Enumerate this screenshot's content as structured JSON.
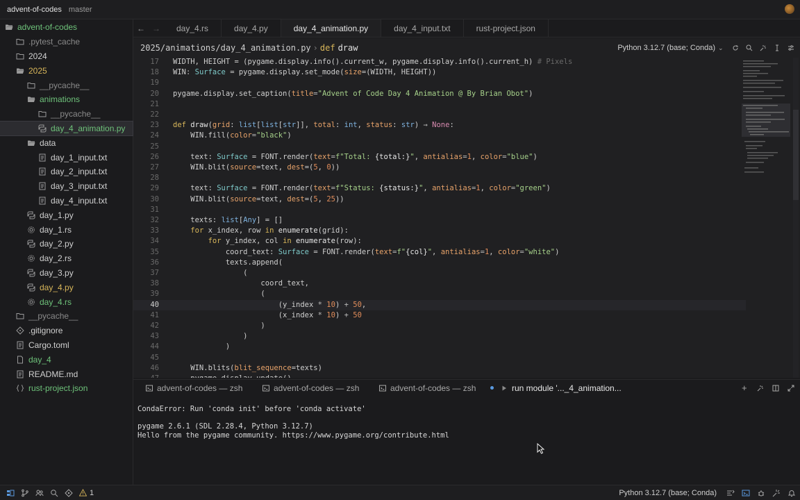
{
  "titlebar": {
    "project": "advent-of-codes",
    "branch": "master"
  },
  "sidebar": {
    "items": [
      {
        "label": "advent-of-codes",
        "icon": "folder-open-icon",
        "depth": 0,
        "color": "green"
      },
      {
        "label": ".pytest_cache",
        "icon": "folder-icon",
        "depth": 1,
        "color": "dim"
      },
      {
        "label": "2024",
        "icon": "folder-icon",
        "depth": 1,
        "color": "white"
      },
      {
        "label": "2025",
        "icon": "folder-open-icon",
        "depth": 1,
        "color": "yellow"
      },
      {
        "label": "__pycache__",
        "icon": "folder-icon",
        "depth": 2,
        "color": "dim"
      },
      {
        "label": "animations",
        "icon": "folder-open-icon",
        "depth": 2,
        "color": "green"
      },
      {
        "label": "__pycache__",
        "icon": "folder-icon",
        "depth": 3,
        "color": "dim"
      },
      {
        "label": "day_4_animation.py",
        "icon": "python-file-icon",
        "depth": 3,
        "color": "green",
        "selected": true
      },
      {
        "label": "data",
        "icon": "folder-open-icon",
        "depth": 2,
        "color": "white"
      },
      {
        "label": "day_1_input.txt",
        "icon": "text-file-icon",
        "depth": 3,
        "color": "white"
      },
      {
        "label": "day_2_input.txt",
        "icon": "text-file-icon",
        "depth": 3,
        "color": "white"
      },
      {
        "label": "day_3_input.txt",
        "icon": "text-file-icon",
        "depth": 3,
        "color": "white"
      },
      {
        "label": "day_4_input.txt",
        "icon": "text-file-icon",
        "depth": 3,
        "color": "white"
      },
      {
        "label": "day_1.py",
        "icon": "python-file-icon",
        "depth": 2,
        "color": "white"
      },
      {
        "label": "day_1.rs",
        "icon": "rust-file-icon",
        "depth": 2,
        "color": "white"
      },
      {
        "label": "day_2.py",
        "icon": "python-file-icon",
        "depth": 2,
        "color": "white"
      },
      {
        "label": "day_2.rs",
        "icon": "rust-file-icon",
        "depth": 2,
        "color": "white"
      },
      {
        "label": "day_3.py",
        "icon": "python-file-icon",
        "depth": 2,
        "color": "white"
      },
      {
        "label": "day_4.py",
        "icon": "python-file-icon",
        "depth": 2,
        "color": "yellow"
      },
      {
        "label": "day_4.rs",
        "icon": "rust-file-icon",
        "depth": 2,
        "color": "green"
      },
      {
        "label": "__pycache__",
        "icon": "folder-icon",
        "depth": 1,
        "color": "dim"
      },
      {
        "label": ".gitignore",
        "icon": "git-icon",
        "depth": 1,
        "color": "white"
      },
      {
        "label": "Cargo.toml",
        "icon": "text-file-icon",
        "depth": 1,
        "color": "white"
      },
      {
        "label": "day_4",
        "icon": "file-icon",
        "depth": 1,
        "color": "green"
      },
      {
        "label": "README.md",
        "icon": "text-file-icon",
        "depth": 1,
        "color": "white"
      },
      {
        "label": "rust-project.json",
        "icon": "json-file-icon",
        "depth": 1,
        "color": "green"
      }
    ]
  },
  "tabs": [
    {
      "label": "day_4.rs"
    },
    {
      "label": "day_4.py"
    },
    {
      "label": "day_4_animation.py",
      "active": true
    },
    {
      "label": "day_4_input.txt"
    },
    {
      "label": "rust-project.json"
    }
  ],
  "breadcrumb": {
    "path": "2025/animations/day_4_animation.py",
    "keyword": "def",
    "symbol": "draw",
    "interpreter": "Python 3.12.7 (base; Conda)"
  },
  "editor": {
    "current_line": 40,
    "lines": [
      {
        "n": 17,
        "tokens": [
          [
            "WIDTH, HEIGHT = (pygame.display.info().current_w, pygame.display.info().current_h) ",
            ""
          ],
          [
            "# Pixels",
            "cm"
          ]
        ]
      },
      {
        "n": 18,
        "tokens": [
          [
            "WIN",
            ""
          ],
          [
            ": ",
            "op"
          ],
          [
            "Surface",
            "cls"
          ],
          [
            " = pygame.display.set_mode(",
            ""
          ],
          [
            "size",
            "param"
          ],
          [
            "=(WIDTH, HEIGHT))",
            ""
          ]
        ]
      },
      {
        "n": 19,
        "tokens": []
      },
      {
        "n": 20,
        "tokens": [
          [
            "pygame.display.set_caption(",
            ""
          ],
          [
            "title",
            "param"
          ],
          [
            "=",
            "op"
          ],
          [
            "\"Advent of Code Day 4 Animation @ By Brian Obot\"",
            "str"
          ],
          [
            ")",
            ""
          ]
        ]
      },
      {
        "n": 21,
        "tokens": []
      },
      {
        "n": 22,
        "tokens": []
      },
      {
        "n": 23,
        "tokens": [
          [
            "def ",
            "kw"
          ],
          [
            "draw",
            "fn"
          ],
          [
            "(",
            ""
          ],
          [
            "grid",
            "param"
          ],
          [
            ": ",
            ""
          ],
          [
            "list",
            "type"
          ],
          [
            "[",
            ""
          ],
          [
            "list",
            "type"
          ],
          [
            "[",
            ""
          ],
          [
            "str",
            "type"
          ],
          [
            "]], ",
            ""
          ],
          [
            "total",
            "param"
          ],
          [
            ": ",
            ""
          ],
          [
            "int",
            "type"
          ],
          [
            ", ",
            ""
          ],
          [
            "status",
            "param"
          ],
          [
            ": ",
            ""
          ],
          [
            "str",
            "type"
          ],
          [
            ") ",
            ""
          ],
          [
            "→ ",
            "op"
          ],
          [
            "None",
            "none"
          ],
          [
            ":",
            ""
          ]
        ]
      },
      {
        "n": 24,
        "tokens": [
          [
            "    WIN.fill(",
            ""
          ],
          [
            "color",
            "param"
          ],
          [
            "=",
            "op"
          ],
          [
            "\"black\"",
            "str"
          ],
          [
            ")",
            ""
          ]
        ]
      },
      {
        "n": 25,
        "tokens": []
      },
      {
        "n": 26,
        "tokens": [
          [
            "    text",
            ""
          ],
          [
            ": ",
            ""
          ],
          [
            "Surface",
            "cls"
          ],
          [
            " = FONT.render(",
            ""
          ],
          [
            "text",
            "param"
          ],
          [
            "=",
            "op"
          ],
          [
            "f\"Total: ",
            "str"
          ],
          [
            "{total:}",
            "tk"
          ],
          [
            "\"",
            "str"
          ],
          [
            ", ",
            ""
          ],
          [
            "antialias",
            "param"
          ],
          [
            "=",
            "op"
          ],
          [
            "1",
            "num"
          ],
          [
            ", ",
            ""
          ],
          [
            "color",
            "param"
          ],
          [
            "=",
            "op"
          ],
          [
            "\"blue\"",
            "str"
          ],
          [
            ")",
            ""
          ]
        ]
      },
      {
        "n": 27,
        "tokens": [
          [
            "    WIN.blit(",
            ""
          ],
          [
            "source",
            "param"
          ],
          [
            "=text, ",
            ""
          ],
          [
            "dest",
            "param"
          ],
          [
            "=(",
            ""
          ],
          [
            "5",
            "num"
          ],
          [
            ", ",
            ""
          ],
          [
            "0",
            "num"
          ],
          [
            "))",
            ""
          ]
        ]
      },
      {
        "n": 28,
        "tokens": []
      },
      {
        "n": 29,
        "tokens": [
          [
            "    text",
            ""
          ],
          [
            ": ",
            ""
          ],
          [
            "Surface",
            "cls"
          ],
          [
            " = FONT.render(",
            ""
          ],
          [
            "text",
            "param"
          ],
          [
            "=",
            "op"
          ],
          [
            "f\"Status: ",
            "str"
          ],
          [
            "{status:}",
            "tk"
          ],
          [
            "\"",
            "str"
          ],
          [
            ", ",
            ""
          ],
          [
            "antialias",
            "param"
          ],
          [
            "=",
            "op"
          ],
          [
            "1",
            "num"
          ],
          [
            ", ",
            ""
          ],
          [
            "color",
            "param"
          ],
          [
            "=",
            "op"
          ],
          [
            "\"green\"",
            "str"
          ],
          [
            ")",
            ""
          ]
        ]
      },
      {
        "n": 30,
        "tokens": [
          [
            "    WIN.blit(",
            ""
          ],
          [
            "source",
            "param"
          ],
          [
            "=text, ",
            ""
          ],
          [
            "dest",
            "param"
          ],
          [
            "=(",
            ""
          ],
          [
            "5",
            "num"
          ],
          [
            ", ",
            ""
          ],
          [
            "25",
            "num"
          ],
          [
            "))",
            ""
          ]
        ]
      },
      {
        "n": 31,
        "tokens": []
      },
      {
        "n": 32,
        "tokens": [
          [
            "    texts",
            ""
          ],
          [
            ": ",
            ""
          ],
          [
            "list",
            "type"
          ],
          [
            "[",
            ""
          ],
          [
            "Any",
            "type"
          ],
          [
            "] = []",
            ""
          ]
        ]
      },
      {
        "n": 33,
        "tokens": [
          [
            "    ",
            ""
          ],
          [
            "for ",
            "kw"
          ],
          [
            "x_index, row ",
            ""
          ],
          [
            "in ",
            "kw"
          ],
          [
            "enumerate",
            "fn"
          ],
          [
            "(grid):",
            ""
          ]
        ]
      },
      {
        "n": 34,
        "tokens": [
          [
            "        ",
            ""
          ],
          [
            "for ",
            "kw"
          ],
          [
            "y_index, col ",
            ""
          ],
          [
            "in ",
            "kw"
          ],
          [
            "enumerate",
            "fn"
          ],
          [
            "(row):",
            ""
          ]
        ]
      },
      {
        "n": 35,
        "tokens": [
          [
            "            coord_text",
            ""
          ],
          [
            ": ",
            ""
          ],
          [
            "Surface",
            "cls"
          ],
          [
            " = FONT.render(",
            ""
          ],
          [
            "text",
            "param"
          ],
          [
            "=",
            "op"
          ],
          [
            "f\"",
            "str"
          ],
          [
            "{col}",
            "tk"
          ],
          [
            "\"",
            "str"
          ],
          [
            ", ",
            ""
          ],
          [
            "antialias",
            "param"
          ],
          [
            "=",
            "op"
          ],
          [
            "1",
            "num"
          ],
          [
            ", ",
            ""
          ],
          [
            "color",
            "param"
          ],
          [
            "=",
            "op"
          ],
          [
            "\"white\"",
            "str"
          ],
          [
            ")",
            ""
          ]
        ]
      },
      {
        "n": 36,
        "tokens": [
          [
            "            texts.append(",
            ""
          ]
        ]
      },
      {
        "n": 37,
        "tokens": [
          [
            "                (",
            ""
          ]
        ]
      },
      {
        "n": 38,
        "tokens": [
          [
            "                    coord_text,",
            ""
          ]
        ]
      },
      {
        "n": 39,
        "tokens": [
          [
            "                    (",
            ""
          ]
        ]
      },
      {
        "n": 40,
        "tokens": [
          [
            "                        (y_index ",
            ""
          ],
          [
            "*",
            "op"
          ],
          [
            " ",
            ""
          ],
          [
            "10",
            "num"
          ],
          [
            ") ",
            ""
          ],
          [
            "+",
            "op"
          ],
          [
            " ",
            ""
          ],
          [
            "50",
            "num"
          ],
          [
            ",",
            ""
          ]
        ]
      },
      {
        "n": 41,
        "tokens": [
          [
            "                        (x_index ",
            ""
          ],
          [
            "*",
            "op"
          ],
          [
            " ",
            ""
          ],
          [
            "10",
            "num"
          ],
          [
            ") ",
            ""
          ],
          [
            "+",
            "op"
          ],
          [
            " ",
            ""
          ],
          [
            "50",
            "num"
          ]
        ]
      },
      {
        "n": 42,
        "tokens": [
          [
            "                    )",
            ""
          ]
        ]
      },
      {
        "n": 43,
        "tokens": [
          [
            "                )",
            ""
          ]
        ]
      },
      {
        "n": 44,
        "tokens": [
          [
            "            )",
            ""
          ]
        ]
      },
      {
        "n": 45,
        "tokens": []
      },
      {
        "n": 46,
        "tokens": [
          [
            "    WIN.blits(",
            ""
          ],
          [
            "blit_sequence",
            "param"
          ],
          [
            "=texts)",
            ""
          ]
        ]
      },
      {
        "n": 47,
        "tokens": [
          [
            "    pygame.display.update()",
            ""
          ]
        ]
      }
    ]
  },
  "terminal": {
    "tabs": [
      {
        "label": "advent-of-codes — zsh"
      },
      {
        "label": "advent-of-codes — zsh"
      },
      {
        "label": "advent-of-codes — zsh"
      },
      {
        "label": "run module '..._4_animation...",
        "active": true
      }
    ],
    "lines": [
      "CondaError: Run 'conda init' before 'conda activate'",
      "",
      "pygame 2.6.1 (SDL 2.28.4, Python 3.12.7)",
      "Hello from the pygame community. https://www.pygame.org/contribute.html"
    ]
  },
  "statusbar": {
    "warning_count": "1",
    "interpreter": "Python 3.12.7 (base; Conda)"
  }
}
